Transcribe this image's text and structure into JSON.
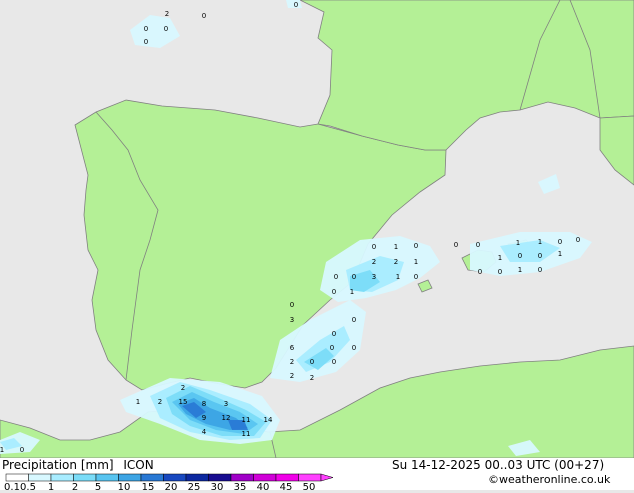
{
  "footer": {
    "title": "Precipitation [mm]",
    "model": "ICON",
    "datetime": "Su 14-12-2025 00..03 UTC (00+27)",
    "credit": "©weatheronline.co.uk"
  },
  "legend": {
    "ticks": [
      "0.1",
      "0.5",
      "1",
      "2",
      "5",
      "10",
      "15",
      "20",
      "25",
      "30",
      "35",
      "40",
      "45",
      "50"
    ],
    "colors": [
      "#ffffff",
      "#d8f8ff",
      "#a8ecff",
      "#7adcf8",
      "#58c4f0",
      "#3ca4e4",
      "#2878d4",
      "#1848c0",
      "#0c28a0",
      "#180c90",
      "#a000c8",
      "#d000d8",
      "#f000e8",
      "#ff40ff"
    ]
  },
  "map": {
    "colors": {
      "sea": "#e8e8e8",
      "land": "#b4f096",
      "border": "#808080"
    },
    "labels": [
      "2",
      "0",
      "0",
      "0",
      "0",
      "0",
      "0",
      "1",
      "0",
      "2",
      "2",
      "1",
      "0",
      "0",
      "3",
      "1",
      "0",
      "0",
      "1",
      "0",
      "0",
      "1",
      "1",
      "0",
      "0",
      "1",
      "0",
      "0",
      "1",
      "0",
      "0",
      "1",
      "0",
      "0",
      "3",
      "0",
      "0",
      "6",
      "0",
      "0",
      "2",
      "0",
      "0",
      "2",
      "2",
      "1",
      "2",
      "15",
      "8",
      "3",
      "9",
      "12",
      "11",
      "14",
      "4",
      "11",
      "2",
      "1",
      "0"
    ]
  }
}
